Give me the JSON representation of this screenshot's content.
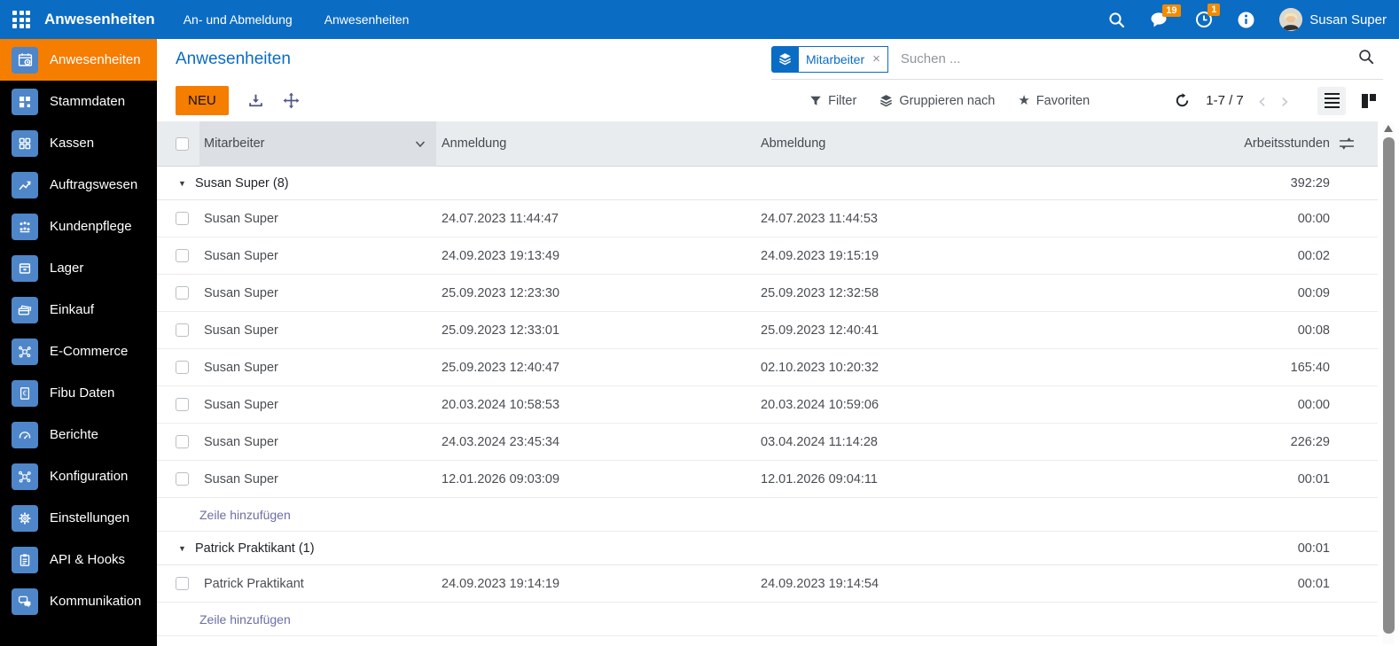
{
  "topbar": {
    "app_title": "Anwesenheiten",
    "menu": [
      {
        "label": "An- und Abmeldung"
      },
      {
        "label": "Anwesenheiten"
      }
    ],
    "chat_badge": "19",
    "activity_badge": "1",
    "user_name": "Susan Super"
  },
  "sidebar": {
    "items": [
      {
        "label": "Anwesenheiten",
        "icon": "calendar-clock-icon",
        "active": true
      },
      {
        "label": "Stammdaten",
        "icon": "blocks-icon",
        "active": false
      },
      {
        "label": "Kassen",
        "icon": "grid-icon",
        "active": false
      },
      {
        "label": "Auftragswesen",
        "icon": "chart-icon",
        "active": false
      },
      {
        "label": "Kundenpflege",
        "icon": "people-icon",
        "active": false
      },
      {
        "label": "Lager",
        "icon": "box-icon",
        "active": false
      },
      {
        "label": "Einkauf",
        "icon": "cards-icon",
        "active": false
      },
      {
        "label": "E-Commerce",
        "icon": "network-icon",
        "active": false
      },
      {
        "label": "Fibu Daten",
        "icon": "document-euro-icon",
        "active": false
      },
      {
        "label": "Berichte",
        "icon": "gauge-icon",
        "active": false
      },
      {
        "label": "Konfiguration",
        "icon": "network-icon",
        "active": false
      },
      {
        "label": "Einstellungen",
        "icon": "gear-icon",
        "active": false
      },
      {
        "label": "API & Hooks",
        "icon": "clipboard-icon",
        "active": false
      },
      {
        "label": "Kommunikation",
        "icon": "chat-icon",
        "active": false
      }
    ]
  },
  "content": {
    "page_title": "Anwesenheiten",
    "search": {
      "facet_label": "Mitarbeiter",
      "facet_close": "×",
      "placeholder": "Suchen ..."
    },
    "toolbar": {
      "new_label": "NEU",
      "filter_label": "Filter",
      "groupby_label": "Gruppieren nach",
      "favorites_label": "Favoriten",
      "favorites_star": "★",
      "pager": "1-7 / 7",
      "prev_glyph": "‹",
      "next_glyph": "›"
    },
    "table": {
      "columns": {
        "mitarbeiter": "Mitarbeiter",
        "anmeldung": "Anmeldung",
        "abmeldung": "Abmeldung",
        "arbeitsstunden": "Arbeitsstunden"
      },
      "add_row_label": "Zeile hinzufügen",
      "group_caret": "▼",
      "groups": [
        {
          "label": "Susan Super (8)",
          "total": "392:29",
          "rows": [
            [
              "Susan Super",
              "24.07.2023 11:44:47",
              "24.07.2023 11:44:53",
              "00:00"
            ],
            [
              "Susan Super",
              "24.09.2023 19:13:49",
              "24.09.2023 19:15:19",
              "00:02"
            ],
            [
              "Susan Super",
              "25.09.2023 12:23:30",
              "25.09.2023 12:32:58",
              "00:09"
            ],
            [
              "Susan Super",
              "25.09.2023 12:33:01",
              "25.09.2023 12:40:41",
              "00:08"
            ],
            [
              "Susan Super",
              "25.09.2023 12:40:47",
              "02.10.2023 10:20:32",
              "165:40"
            ],
            [
              "Susan Super",
              "20.03.2024 10:58:53",
              "20.03.2024 10:59:06",
              "00:00"
            ],
            [
              "Susan Super",
              "24.03.2024 23:45:34",
              "03.04.2024 11:14:28",
              "226:29"
            ],
            [
              "Susan Super",
              "12.01.2026 09:03:09",
              "12.01.2026 09:04:11",
              "00:01"
            ]
          ]
        },
        {
          "label": "Patrick Praktikant (1)",
          "total": "00:01",
          "rows": [
            [
              "Patrick Praktikant",
              "24.09.2023 19:14:19",
              "24.09.2023 19:14:54",
              "00:01"
            ]
          ]
        }
      ]
    }
  },
  "colors": {
    "topbar_blue": "#0b6cc3",
    "accent_orange": "#f57d00",
    "badge_orange": "#f28b00",
    "sidebar_bg": "#000000",
    "sidebar_icon_blue": "#4e86c9",
    "link_blue": "#0b6cc3",
    "header_bg": "#e9ecef",
    "header_sorted_bg": "#dcdfe3",
    "addrow_link_slate": "#6a6fa3",
    "toolbar_icon_slate": "#4f5486",
    "table_text": "#494d52"
  }
}
